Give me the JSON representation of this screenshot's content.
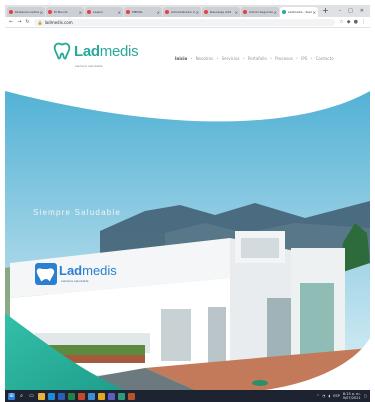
{
  "browser": {
    "tabs": [
      {
        "title": "Mudanza Ladmedis B",
        "active": false
      },
      {
        "title": "El Mundo",
        "active": false
      },
      {
        "title": "Laspnl",
        "active": false
      },
      {
        "title": "MEDOL",
        "active": false
      },
      {
        "title": "Administrador Adit",
        "active": false
      },
      {
        "title": "Descarga Adit",
        "active": false
      },
      {
        "title": "Admin Seguridad",
        "active": false
      },
      {
        "title": "Ladmedis - Siempre",
        "active": true
      }
    ],
    "new_tab": "+",
    "window_controls": [
      "–",
      "□",
      "✕"
    ],
    "url": "ladmedis.com"
  },
  "site": {
    "logo": {
      "name_bold": "Lad",
      "name_thin": "medis",
      "tagline": "siempre saludable"
    },
    "menu": [
      {
        "label": "Inicio",
        "active": true
      },
      {
        "label": "Nosotros",
        "active": false
      },
      {
        "label": "Servicios",
        "active": false
      },
      {
        "label": "Portafolio",
        "active": false
      },
      {
        "label": "Procesos",
        "active": false
      },
      {
        "label": "IPS",
        "active": false
      },
      {
        "label": "Contacto",
        "active": false
      }
    ],
    "hero": {
      "slogan": "Siempre Saludable",
      "building_logo": {
        "name_bold": "Lad",
        "name_thin": "medis",
        "tagline": "siempre saludable"
      }
    }
  },
  "taskbar": {
    "time": "8:15 a. m.",
    "date": "9/07/2021",
    "lang": "ESP"
  },
  "colors": {
    "brand_teal": "#2aa89a",
    "hero_sky_top": "#5ab7d6",
    "hero_sky_bottom": "#d7eef6",
    "taskbar": "#1d2330"
  }
}
